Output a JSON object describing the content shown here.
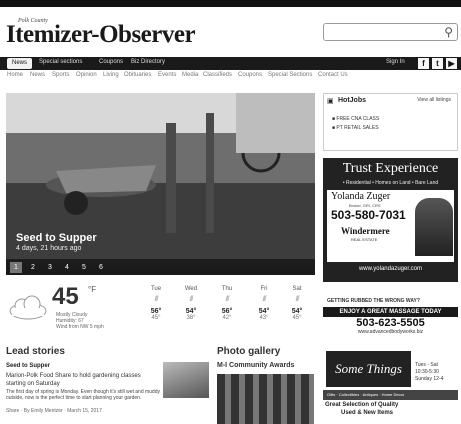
{
  "logo": {
    "county": "Polk County",
    "name": "Itemizer-Observer"
  },
  "search": {
    "placeholder": ""
  },
  "nav": {
    "items": [
      "News",
      "Special sections",
      "Coupons",
      "Biz Directory"
    ],
    "signin": "Sign In"
  },
  "social": {
    "facebook": "f",
    "twitter": "t",
    "youtube": "▶"
  },
  "subnav": [
    "Home",
    "News",
    "Sports",
    "Opinion",
    "Living",
    "Obituaries",
    "Events",
    "Media",
    "Classifieds",
    "Coupons",
    "Special Sections",
    "Contact Us"
  ],
  "hero": {
    "title": "Seed to Supper",
    "time": "4 days, 21 hours ago",
    "pages": [
      "1",
      "2",
      "3",
      "4",
      "5",
      "6"
    ]
  },
  "weather": {
    "temp": "45",
    "unit": "°F",
    "condition": "Mostly Cloudy",
    "humidity": "Humidity: 67",
    "wind": "Wind from NW 5 mph",
    "days": [
      {
        "name": "Tue",
        "hi": "56°",
        "lo": "45°"
      },
      {
        "name": "Wed",
        "hi": "54°",
        "lo": "38°"
      },
      {
        "name": "Thu",
        "hi": "56°",
        "lo": "42°"
      },
      {
        "name": "Fri",
        "hi": "54°",
        "lo": "43°"
      },
      {
        "name": "Sat",
        "hi": "54°",
        "lo": "45°"
      }
    ]
  },
  "lead": {
    "heading": "Lead stories",
    "title": "Seed to Supper",
    "line1": "Marion-Polk Food Share to hold gardening classes starting on Saturday",
    "body": "The first day of spring is Monday. Even though it's still wet and muddy outside, now is the perfect time to start planning your garden.",
    "meta": "Share · By Emily Mentzer · March 15, 2017"
  },
  "photo": {
    "heading": "Photo gallery",
    "subtitle": "M-I Community Awards"
  },
  "hotjobs": {
    "title": "HotJobs",
    "view_all": "View all listings",
    "items": [
      "FREE CNA CLASS",
      "PT RETAIL SALES"
    ]
  },
  "trust_ad": {
    "title": "Trust Experience",
    "subtitle": "• Residential • Homes on Land • Bare Land",
    "name": "Yolanda Zuger",
    "role": "Broker, GRI, CRS",
    "phone": "503-580-7031",
    "brand": "Windermere",
    "brand_sub": "REAL ESTATE",
    "url": "www.yolandazuger.com"
  },
  "massage_ad": {
    "top": "GETTING RUBBED THE WRONG WAY?",
    "band": "ENJOY A GREAT MASSAGE TODAY",
    "phone": "503-623-5505",
    "url": "www.advancedbodyworks.biz"
  },
  "things_ad": {
    "logo": "Some Things",
    "hours1": "Tues - Sat",
    "hours2": "10:30-5:30",
    "hours3": "Sunday 12-4",
    "strip": "Gifts · Collectibles · Antiques · Home Decor",
    "tag1": "Great Selection of Quality",
    "tag2": "Used & New Items"
  }
}
